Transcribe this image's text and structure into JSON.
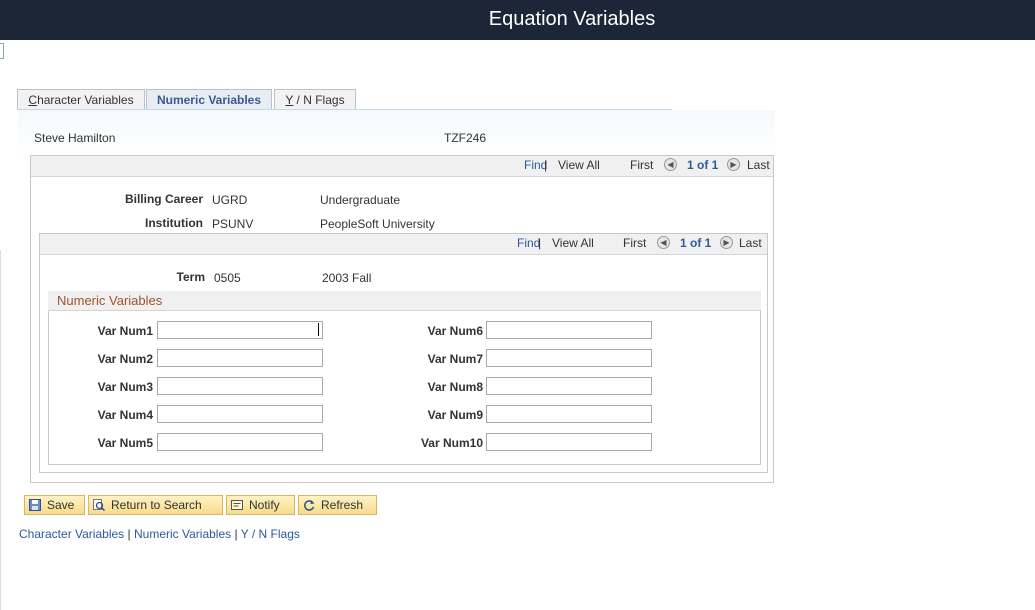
{
  "header": {
    "title": "Equation Variables"
  },
  "tabs": [
    {
      "prefix": "C",
      "rest": "haracter Variables"
    },
    {
      "label": "Numeric Variables"
    },
    {
      "prefix": "Y",
      "rest": " / N Flags"
    }
  ],
  "person": {
    "name": "Steve Hamilton",
    "id": "TZF246"
  },
  "nav1": {
    "find": "Find",
    "sep": "|",
    "view_all": "View All",
    "first": "First",
    "count": "1 of 1",
    "last": "Last"
  },
  "billing": {
    "label": "Billing Career",
    "code": "UGRD",
    "desc": "Undergraduate"
  },
  "institution": {
    "label": "Institution",
    "code": "PSUNV",
    "desc": "PeopleSoft University"
  },
  "nav2": {
    "find": "Find",
    "sep": "|",
    "view_all": "View All",
    "first": "First",
    "count": "1 of 1",
    "last": "Last"
  },
  "term": {
    "label": "Term",
    "code": "0505",
    "desc": "2003 Fall"
  },
  "group_title": "Numeric Variables",
  "vars_left": [
    "Var Num1",
    "Var Num2",
    "Var Num3",
    "Var Num4",
    "Var Num5"
  ],
  "vars_right": [
    "Var Num6",
    "Var Num7",
    "Var Num8",
    "Var Num9",
    "Var Num10"
  ],
  "buttons": {
    "save": "Save",
    "return": "Return to Search",
    "notify": "Notify",
    "refresh": "Refresh"
  },
  "footer_links": {
    "char": "Character Variables",
    "sep": "|",
    "num": "Numeric Variables",
    "flags": "Y / N Flags"
  }
}
